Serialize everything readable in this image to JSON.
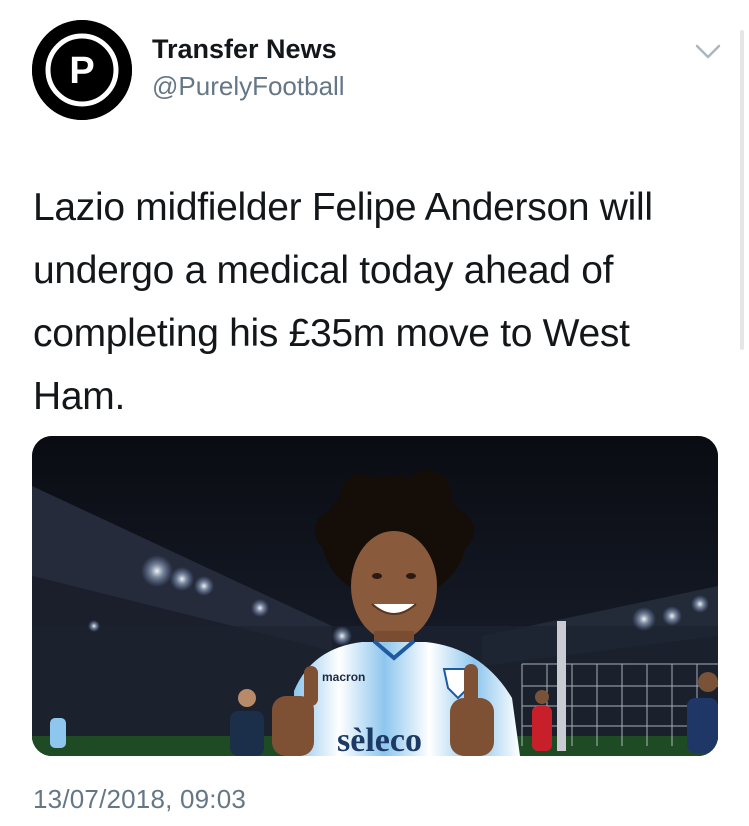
{
  "author": {
    "display_name": "Transfer News",
    "handle": "@PurelyFootball",
    "avatar_icon": "purely-football-logo-icon",
    "avatar_letter": "P"
  },
  "tweet": {
    "text": "Lazio midfielder Felipe Anderson will undergo a medical today ahead of completing his £35m move to West Ham.",
    "timestamp": "13/07/2018, 09:03"
  },
  "menu": {
    "icon": "chevron-down-icon"
  },
  "media": {
    "description_icon": "player-photo",
    "kit_brand": "macron",
    "kit_sponsor": "sèleco"
  },
  "colors": {
    "text_primary": "#14171a",
    "text_secondary": "#657786",
    "chevron": "#aab8c2"
  }
}
